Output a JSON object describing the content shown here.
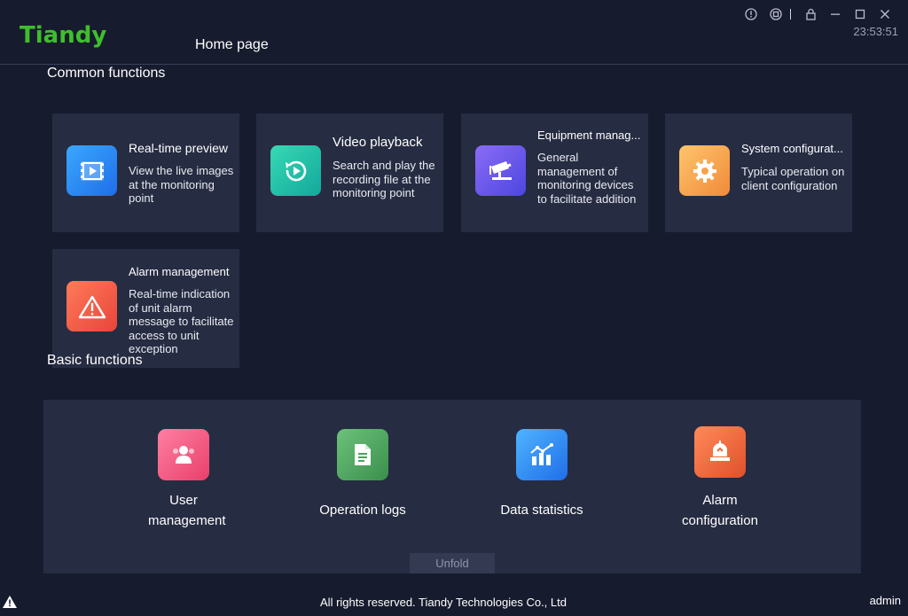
{
  "app": {
    "logo": "Tiandy",
    "nav_home": "Home page",
    "clock": "23:53:51",
    "user": "admin"
  },
  "window_controls": [
    "info-icon",
    "record-icon",
    "lock-icon",
    "minimize-icon",
    "maximize-icon",
    "close-icon"
  ],
  "common": {
    "title": "Common functions",
    "cards": [
      {
        "title": "Real-time preview",
        "desc": "View the live images at the monitoring point",
        "icon": "video-play-icon",
        "color": "#2f8cf0"
      },
      {
        "title": "Video playback",
        "desc": "Search and play the recording file at the monitoring point",
        "icon": "playback-icon",
        "color": "#25c2a8"
      },
      {
        "title": "Equipment manag...",
        "desc": "General management of monitoring devices to facilitate addition",
        "icon": "camera-icon",
        "color": "#6d58e8"
      },
      {
        "title": "System configurat...",
        "desc": "Typical operation on client configuration",
        "icon": "gear-icon",
        "color": "#f5a34a"
      },
      {
        "title": "Alarm management",
        "desc": "Real-time indication of unit alarm message to facilitate access to unit exception",
        "icon": "warning-icon",
        "color": "#f0604a"
      }
    ]
  },
  "basic": {
    "title": "Basic functions",
    "items": [
      {
        "label": "User management",
        "icon": "users-icon",
        "color": "#f0577f"
      },
      {
        "label": "Operation logs",
        "icon": "document-icon",
        "color": "#4aa35c"
      },
      {
        "label": "Data statistics",
        "icon": "chart-icon",
        "color": "#2f8cf0"
      },
      {
        "label": "Alarm configuration",
        "icon": "alarm-icon",
        "color": "#f0673a"
      }
    ],
    "unfold": "Unfold"
  },
  "footer": {
    "copyright": "All rights reserved. Tiandy Technologies Co., Ltd"
  }
}
